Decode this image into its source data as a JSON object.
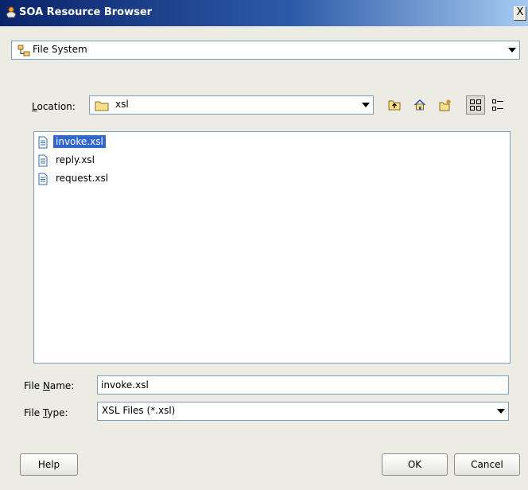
{
  "window": {
    "title": "SOA Resource Browser",
    "close_label": "X"
  },
  "source_selector": {
    "value": "File System"
  },
  "location": {
    "label_prefix": "",
    "label_hotkey": "L",
    "label_rest": "ocation:",
    "value": "xsl"
  },
  "toolbar": {
    "buttons": [
      "up-folder",
      "home",
      "new-folder",
      "icon-view",
      "list-view"
    ],
    "active": "icon-view"
  },
  "files": [
    {
      "name": "invoke.xsl",
      "selected": true
    },
    {
      "name": "reply.xsl",
      "selected": false
    },
    {
      "name": "request.xsl",
      "selected": false
    }
  ],
  "file_name": {
    "label_prefix": "File ",
    "label_hotkey": "N",
    "label_rest": "ame:",
    "value": "invoke.xsl"
  },
  "file_type": {
    "label_prefix": "File ",
    "label_hotkey": "T",
    "label_rest": "ype:",
    "value": "XSL Files (*.xsl)"
  },
  "buttons": {
    "help": "Help",
    "ok": "OK",
    "cancel": "Cancel"
  },
  "colors": {
    "title_bar_start": "#0a246a",
    "selection": "#3366cc",
    "dialog_bg": "#ecece4"
  }
}
